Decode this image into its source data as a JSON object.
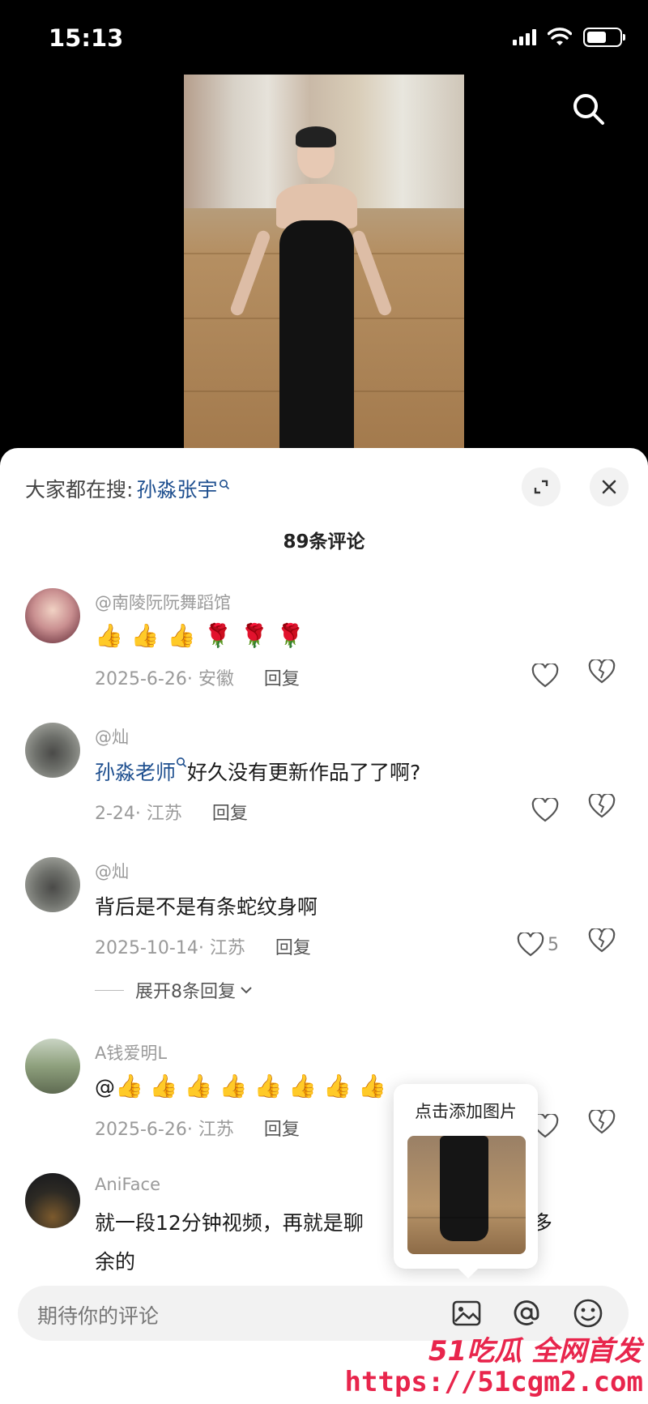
{
  "status": {
    "time": "15:13",
    "battery_level": 0.6
  },
  "sheet": {
    "hot_search_prefix": "大家都在搜:",
    "hot_search_keyword": "孙淼张宇",
    "comment_count_title": "89条评论"
  },
  "comments": [
    {
      "user": "@南陵阮阮舞蹈馆",
      "text_emojis": [
        "👍",
        "👍",
        "👍",
        "🌹",
        "🌹",
        "🌹"
      ],
      "date_location": "2025-6-26· 安徽",
      "reply": "回复",
      "likes": ""
    },
    {
      "user": "@灿",
      "tag": "孙淼老师",
      "text": "好久没有更新作品了了啊?",
      "date_location": "2-24· 江苏",
      "reply": "回复",
      "likes": ""
    },
    {
      "user": "@灿",
      "text": "背后是不是有条蛇纹身啊",
      "date_location": "2025-10-14· 江苏",
      "reply": "回复",
      "likes": "5"
    },
    {
      "user": "A钱爱明L",
      "text_prefix": "@",
      "text_emojis": [
        "👍",
        "👍",
        "👍",
        "👍",
        "👍",
        "👍",
        "👍",
        "👍"
      ],
      "date_location": "2025-6-26· 江苏",
      "reply": "回复",
      "likes": ""
    },
    {
      "user": "AniFace",
      "text_line1_a": "就一段12分钟视频，再就是聊",
      "text_line1_b": "没有多",
      "text_line2": "余的"
    }
  ],
  "expand_replies": "展开8条回复",
  "popup": {
    "title": "点击添加图片"
  },
  "input": {
    "placeholder": "期待你的评论"
  },
  "watermark": {
    "line1": "51吃瓜 全网首发",
    "line2": "https://51cgm2.com"
  },
  "colors": {
    "link": "#1e4f8f",
    "watermark": "#e8254c"
  }
}
